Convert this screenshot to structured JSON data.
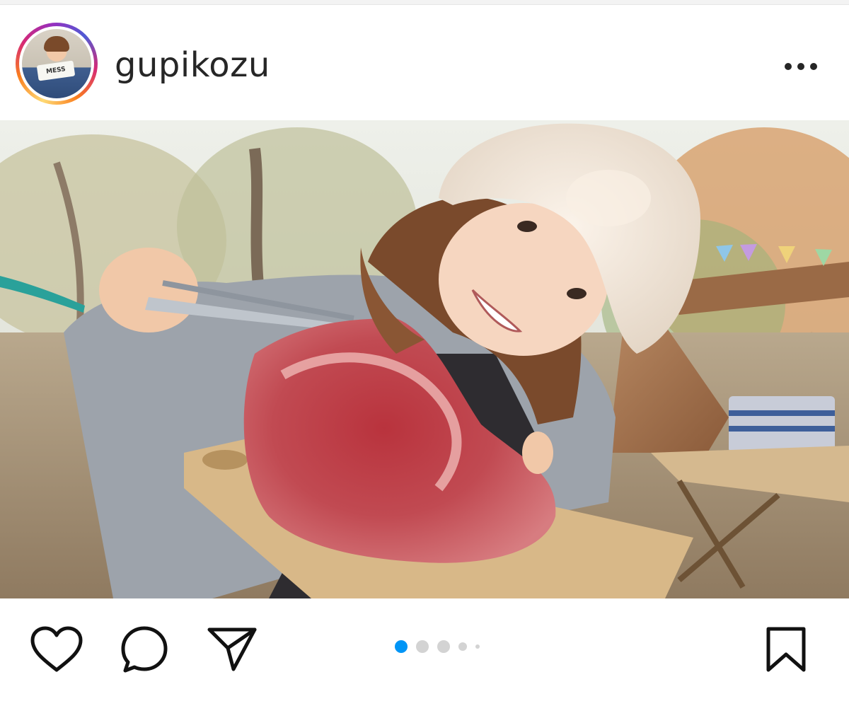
{
  "post": {
    "username": "gupikozu",
    "avatar_sign_text": "MESS",
    "media_count_dots": 5,
    "active_dot_index": 0,
    "colors": {
      "active_dot": "#0095f6",
      "inactive_dot": "#d3d3d3",
      "text": "#262626"
    }
  },
  "icons": {
    "more": "more-horizontal-icon",
    "like": "heart-icon",
    "comment": "comment-bubble-icon",
    "share": "paper-plane-icon",
    "save": "bookmark-icon"
  }
}
